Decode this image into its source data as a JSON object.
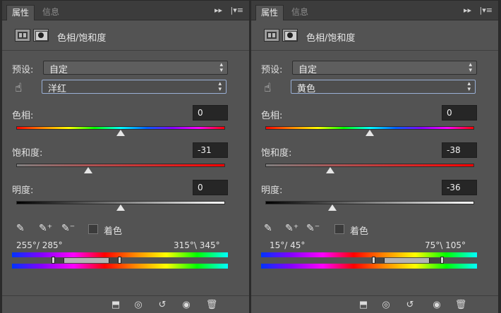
{
  "panels": [
    {
      "tabs": {
        "active": "属性",
        "inactive": "信息"
      },
      "title": "色相/饱和度",
      "preset": {
        "label": "预设:",
        "value": "自定"
      },
      "channel": {
        "value": "洋红"
      },
      "hue": {
        "label": "色相:",
        "value": "0",
        "slider_fraction": 0.5
      },
      "saturation": {
        "label": "饱和度:",
        "value": "-31",
        "slider_fraction": 0.345
      },
      "lightness": {
        "label": "明度:",
        "value": "0",
        "slider_fraction": 0.5
      },
      "colorize": {
        "label": "着色"
      },
      "range": {
        "left": "255°/ 285°",
        "right": "315°\\ 345°",
        "band_start": 0.19,
        "core_start": 0.24,
        "core_end": 0.45,
        "band_end": 0.5
      },
      "icons": [
        "panel-menu-icon",
        "expand-icon",
        "layer-clip-icon",
        "visibility-icon",
        "reset-icon",
        "eye-icon",
        "trash-icon"
      ]
    },
    {
      "tabs": {
        "active": "属性",
        "inactive": "信息"
      },
      "title": "色相/饱和度",
      "preset": {
        "label": "预设:",
        "value": "自定"
      },
      "channel": {
        "value": "黄色"
      },
      "hue": {
        "label": "色相:",
        "value": "0",
        "slider_fraction": 0.5
      },
      "saturation": {
        "label": "饱和度:",
        "value": "-38",
        "slider_fraction": 0.31
      },
      "lightness": {
        "label": "明度:",
        "value": "-36",
        "slider_fraction": 0.32
      },
      "colorize": {
        "label": "着色"
      },
      "range": {
        "left": "15°/ 45°",
        "right": "75°\\ 105°",
        "band_start": 0.52,
        "core_start": 0.57,
        "core_end": 0.78,
        "band_end": 0.84
      },
      "icons": [
        "panel-menu-icon",
        "expand-icon",
        "layer-clip-icon",
        "visibility-icon",
        "reset-icon",
        "eye-icon",
        "trash-icon"
      ]
    }
  ]
}
